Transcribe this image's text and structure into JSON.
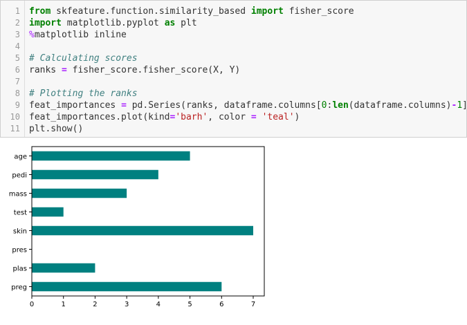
{
  "code_cell": {
    "lines": [
      [
        [
          "kw",
          "from"
        ],
        [
          "pl",
          " skfeature.function.similarity_based "
        ],
        [
          "kw",
          "import"
        ],
        [
          "pl",
          " fisher_score"
        ]
      ],
      [
        [
          "kw",
          "import"
        ],
        [
          "pl",
          " matplotlib.pyplot "
        ],
        [
          "kw",
          "as"
        ],
        [
          "pl",
          " plt"
        ]
      ],
      [
        [
          "mg",
          "%"
        ],
        [
          "pl",
          "matplotlib inline"
        ]
      ],
      [],
      [
        [
          "cm",
          "# Calculating scores"
        ]
      ],
      [
        [
          "pl",
          "ranks "
        ],
        [
          "op",
          "="
        ],
        [
          "pl",
          " fisher_score.fisher_score(X, Y)"
        ]
      ],
      [],
      [
        [
          "cm",
          "# Plotting the ranks"
        ]
      ],
      [
        [
          "pl",
          "feat_importances "
        ],
        [
          "op",
          "="
        ],
        [
          "pl",
          " pd.Series(ranks, dataframe.columns["
        ],
        [
          "nu",
          "0"
        ],
        [
          "pl",
          ":"
        ],
        [
          "kw",
          "len"
        ],
        [
          "pl",
          "(dataframe.columns)"
        ],
        [
          "op",
          "-"
        ],
        [
          "nu",
          "1"
        ],
        [
          "pl",
          "])"
        ]
      ],
      [
        [
          "pl",
          "feat_importances.plot(kind"
        ],
        [
          "op",
          "="
        ],
        [
          "st",
          "'barh'"
        ],
        [
          "pl",
          ", color "
        ],
        [
          "op",
          "="
        ],
        [
          "pl",
          " "
        ],
        [
          "st",
          "'teal'"
        ],
        [
          "pl",
          ")"
        ]
      ],
      [
        [
          "pl",
          "plt.show()"
        ]
      ]
    ]
  },
  "chart_data": {
    "type": "bar",
    "orientation": "horizontal",
    "categories": [
      "preg",
      "plas",
      "pres",
      "skin",
      "test",
      "mass",
      "pedi",
      "age"
    ],
    "values": [
      6,
      2,
      0,
      7,
      1,
      3,
      4,
      5
    ],
    "xlim": [
      0,
      7.35
    ],
    "xticks": [
      "0",
      "1",
      "2",
      "3",
      "4",
      "5",
      "6",
      "7"
    ],
    "color": "#008080",
    "title": "",
    "xlabel": "",
    "ylabel": "",
    "grid": false
  }
}
